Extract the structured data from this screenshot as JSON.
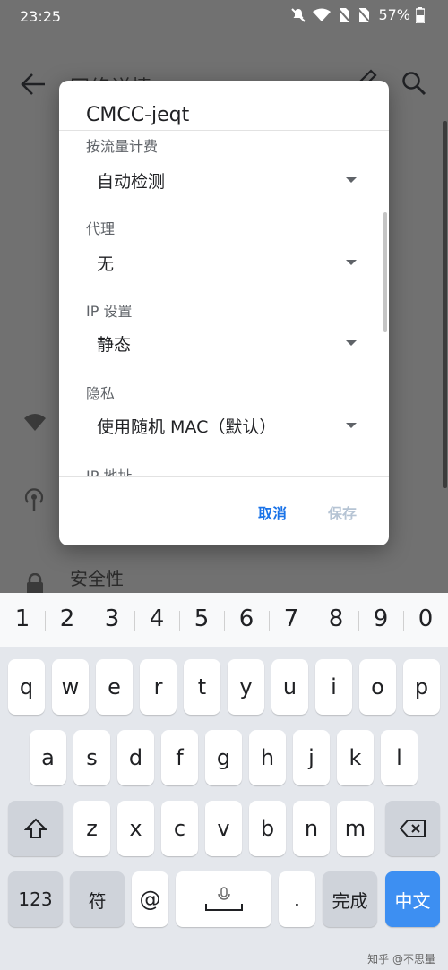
{
  "status": {
    "time": "23:25",
    "battery": "57%"
  },
  "background": {
    "title": "网络详情",
    "security_label": "安全性"
  },
  "dialog": {
    "title": "CMCC-jeqt",
    "fields": [
      {
        "label": "按流量计费",
        "value": "自动检测"
      },
      {
        "label": "代理",
        "value": "无"
      },
      {
        "label": "IP 设置",
        "value": "静态"
      },
      {
        "label": "隐私",
        "value": "使用随机 MAC（默认）"
      },
      {
        "label": "IP 地址",
        "value": ""
      }
    ],
    "cancel": "取消",
    "save": "保存"
  },
  "keyboard": {
    "numbers": [
      "1",
      "2",
      "3",
      "4",
      "5",
      "6",
      "7",
      "8",
      "9",
      "0"
    ],
    "row1": [
      "q",
      "w",
      "e",
      "r",
      "t",
      "y",
      "u",
      "i",
      "o",
      "p"
    ],
    "row2": [
      "a",
      "s",
      "d",
      "f",
      "g",
      "h",
      "j",
      "k",
      "l"
    ],
    "row3": [
      "z",
      "x",
      "c",
      "v",
      "b",
      "n",
      "m"
    ],
    "key_123": "123",
    "key_symbol": "符",
    "key_at": "@",
    "key_dot": ".",
    "key_done": "完成",
    "key_lang": "中文"
  },
  "watermark": "知乎 @不思量",
  "colors": {
    "accent": "#1a73e8",
    "enter_key": "#3d8ff2"
  }
}
